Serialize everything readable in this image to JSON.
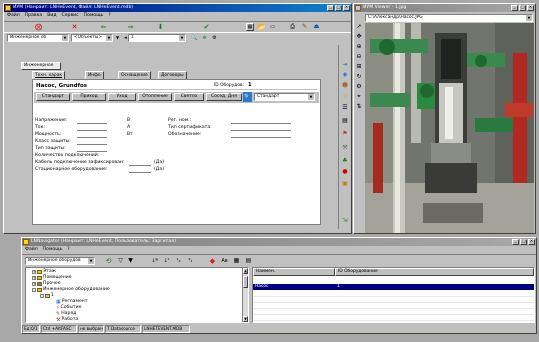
{
  "main": {
    "title": "ИУМ (Нанраит: LNHeEvent, Файл: LNHeEvent.mdb)",
    "menu": [
      "Файл",
      "Правка",
      "Вид",
      "Сервис",
      "Помощь",
      "?"
    ],
    "combo1": "Инженерное об",
    "combo2": "<Объекты>",
    "combo3": "1",
    "pill": "Инженерное",
    "tabs": [
      "Техн. харак",
      "Инфо",
      "Оснащение",
      "Договоры"
    ],
    "header_title": "Насос, Grundfos",
    "header_id_label": "ID Оборудов:",
    "header_id_value": "1",
    "buttons": [
      "Стандарт",
      "Приход",
      "Уход",
      "Отопление",
      "Светло",
      "Сосед. Дня"
    ],
    "button_select": "Стандарт",
    "fields_left": [
      {
        "label": "Напряжение:",
        "unit": "В"
      },
      {
        "label": "Ток:",
        "unit": "А"
      },
      {
        "label": "Мощность:",
        "unit": "Вт"
      },
      {
        "label": "Класс защиты:",
        "unit": ""
      },
      {
        "label": "Тип защиты:",
        "unit": ""
      },
      {
        "label": "Количество подключений:",
        "unit": ""
      },
      {
        "label": "Кабель подключение зафиксирован:",
        "unit": "(Да)"
      },
      {
        "label": "Стационарное оборудование:",
        "unit": "(Да)"
      }
    ],
    "fields_right": [
      "Рег. ном.:",
      "Тип сертификата:",
      "Обозначение:"
    ]
  },
  "viewer": {
    "title": "ИУМ Viewer - 1.jpg",
    "path": "C:\\Александр\\Насос.JPG"
  },
  "navigator": {
    "title": "LNNavigator (Нанраит: LNHeEvent, Пользователь: Заргитал)",
    "menu": [
      "Файл",
      "Помощь",
      "?"
    ],
    "combo": "Инженерное оборудов",
    "tree": [
      "Этаж",
      "Помещение",
      "Прочее",
      "Инженерное оборудование",
      "1",
      "Регламент",
      "Событие",
      "Наряд",
      "Работа"
    ],
    "columns": [
      "Наимен.",
      "ID Оборудование"
    ],
    "row": {
      "name": "Насос",
      "id": "1"
    }
  },
  "statusbar": [
    "Ед:0/1",
    "Ctrl +AltFASC",
    "не выбран",
    "T Datasource",
    "LNHETEVENT.MDB"
  ],
  "colors": {
    "title_active": "#000080",
    "select": "#000080",
    "panel": "#c0c0c0"
  }
}
